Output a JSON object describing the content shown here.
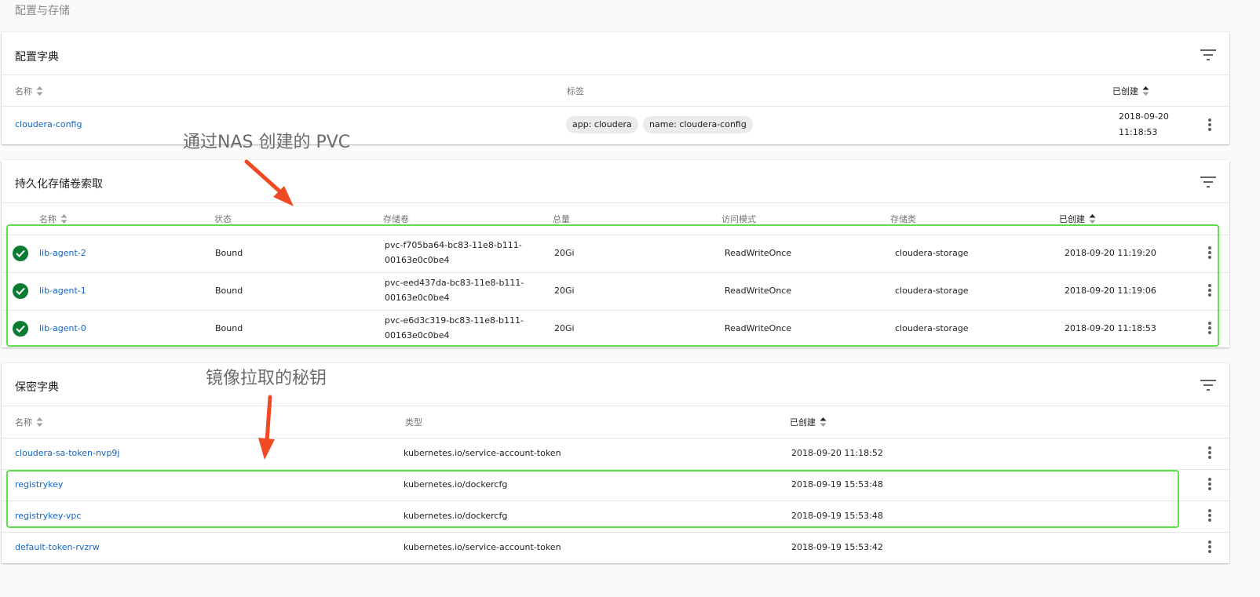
{
  "page_title": "配置与存储",
  "configmaps": {
    "title": "配置字典",
    "headers": {
      "name": "名称",
      "labels": "标签",
      "created": "已创建"
    },
    "rows": [
      {
        "name": "cloudera-config",
        "labels": [
          "app: cloudera",
          "name: cloudera-config"
        ],
        "created_date": "2018-09-20",
        "created_time": "11:18:53"
      }
    ]
  },
  "pvc": {
    "title": "持久化存储卷索取",
    "headers": {
      "name": "名称",
      "status": "状态",
      "volume": "存储卷",
      "capacity": "总量",
      "access_mode": "访问模式",
      "storage_class": "存储类",
      "created": "已创建"
    },
    "rows": [
      {
        "name": "lib-agent-2",
        "status": "Bound",
        "volume_line1": "pvc-f705ba64-bc83-11e8-b111-",
        "volume_line2": "00163e0c0be4",
        "capacity": "20Gi",
        "access_mode": "ReadWriteOnce",
        "storage_class": "cloudera-storage",
        "created": "2018-09-20 11:19:20"
      },
      {
        "name": "lib-agent-1",
        "status": "Bound",
        "volume_line1": "pvc-eed437da-bc83-11e8-b111-",
        "volume_line2": "00163e0c0be4",
        "capacity": "20Gi",
        "access_mode": "ReadWriteOnce",
        "storage_class": "cloudera-storage",
        "created": "2018-09-20 11:19:06"
      },
      {
        "name": "lib-agent-0",
        "status": "Bound",
        "volume_line1": "pvc-e6d3c319-bc83-11e8-b111-",
        "volume_line2": "00163e0c0be4",
        "capacity": "20Gi",
        "access_mode": "ReadWriteOnce",
        "storage_class": "cloudera-storage",
        "created": "2018-09-20 11:18:53"
      }
    ]
  },
  "secrets": {
    "title": "保密字典",
    "headers": {
      "name": "名称",
      "type": "类型",
      "created": "已创建"
    },
    "rows": [
      {
        "name": "cloudera-sa-token-nvp9j",
        "type": "kubernetes.io/service-account-token",
        "created": "2018-09-20 11:18:52"
      },
      {
        "name": "registrykey",
        "type": "kubernetes.io/dockercfg",
        "created": "2018-09-19 15:53:48"
      },
      {
        "name": "registrykey-vpc",
        "type": "kubernetes.io/dockercfg",
        "created": "2018-09-19 15:53:48"
      },
      {
        "name": "default-token-rvzrw",
        "type": "kubernetes.io/service-account-token",
        "created": "2018-09-19 15:53:42"
      }
    ]
  },
  "annotations": {
    "pvc_note": "通过NAS 创建的 PVC",
    "secret_note": "镜像拉取的秘钥",
    "arrow_color": "#f04a25",
    "highlight_color": "#5ee04a"
  },
  "icons": {
    "filter": "filter-list-icon",
    "sort": "sort-arrows-icon",
    "more": "more-vert-icon",
    "status_ok": "check-circle-icon"
  }
}
